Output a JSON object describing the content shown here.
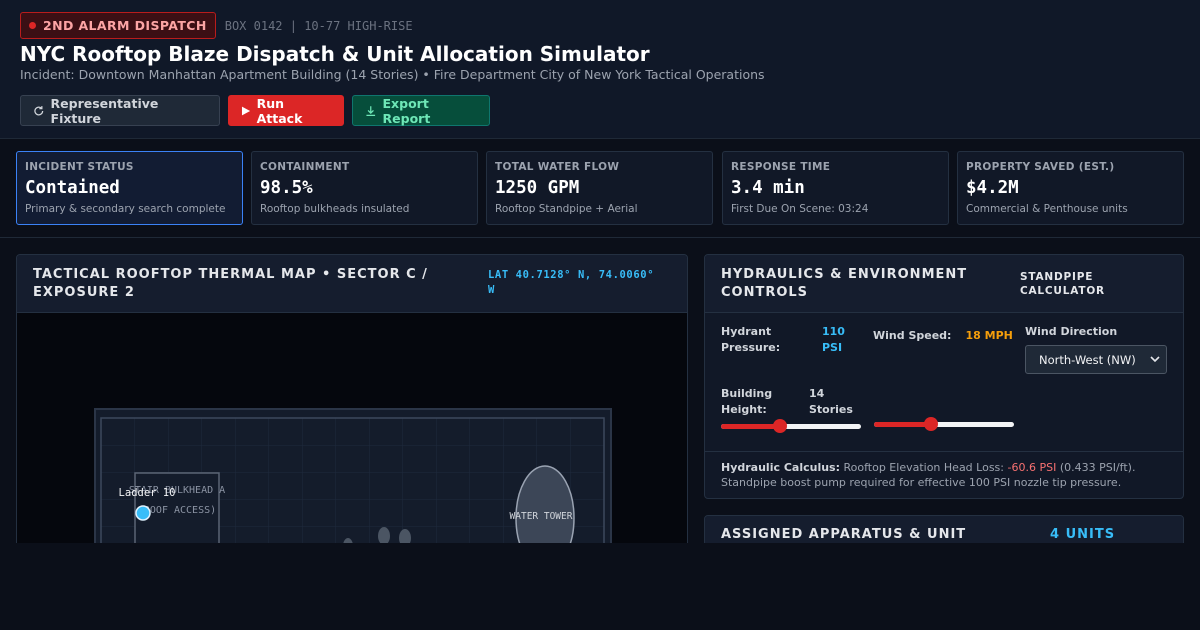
{
  "header": {
    "alarm_badge": "2ND ALARM DISPATCH",
    "box_code": "BOX 0142 | 10-77 HIGH-RISE",
    "title": "NYC Rooftop Blaze Dispatch & Unit Allocation Simulator",
    "subtitle": "Incident: Downtown Manhattan Apartment Building (14 Stories) • Fire Department City of New York Tactical Operations",
    "buttons": {
      "fixture": "Representative Fixture",
      "run": "Run Attack",
      "export": "Export Report"
    }
  },
  "stats": [
    {
      "label": "INCIDENT STATUS",
      "value": "Contained",
      "note": "Primary & secondary search complete"
    },
    {
      "label": "CONTAINMENT",
      "value": "98.5%",
      "note": "Rooftop bulkheads insulated"
    },
    {
      "label": "TOTAL WATER FLOW",
      "value": "1250 GPM",
      "note": "Rooftop Standpipe + Aerial"
    },
    {
      "label": "RESPONSE TIME",
      "value": "3.4 min",
      "note": "First Due On Scene: 03:24"
    },
    {
      "label": "PROPERTY SAVED (EST.)",
      "value": "$4.2M",
      "note": "Commercial & Penthouse units"
    }
  ],
  "map": {
    "title_line1": "TACTICAL ROOFTOP THERMAL MAP • SECTOR C /",
    "title_line2": "EXPOSURE 2",
    "coords_line1": "LAT 40.7128° N, 74.0060°",
    "coords_line2": "W",
    "bulkhead_line1": "STAIR BULKHEAD A",
    "bulkhead_line2": "(ROOF ACCESS)",
    "unit_label": "Ladder 10",
    "water_tower": "WATER TOWER"
  },
  "hydraulics": {
    "title_line1": "HYDRAULICS & ENVIRONMENT",
    "title_line2": "CONTROLS",
    "calc_line1": "STANDPIPE",
    "calc_line2": "CALCULATOR",
    "hydrant_label_1": "Hydrant",
    "hydrant_label_2": "Pressure:",
    "hydrant_value_1": "110",
    "hydrant_value_2": "PSI",
    "hydrant_level": 0.42,
    "wind_label": "Wind Speed:",
    "wind_value": "18 MPH",
    "wind_level": 0.41,
    "direction_label": "Wind Direction",
    "direction_selected": "North-West (NW)",
    "height_label_1": "Building",
    "height_label_2": "Height:",
    "height_value_1": "14",
    "height_value_2": "Stories",
    "height_level": 0.4,
    "calc_heading": "Hydraulic Calculus:",
    "calc_text_1": "Rooftop Elevation Head Loss:",
    "calc_loss": "-60.6 PSI",
    "calc_text_2": "(0.433 PSI/ft).",
    "calc_text_3": "Standpipe boost pump required for effective 100 PSI nozzle tip pressure."
  },
  "apparatus": {
    "title": "ASSIGNED APPARATUS & UNIT",
    "count": "4 UNITS"
  },
  "colors": {
    "accent_red": "#dc2626",
    "accent_blue": "#38bdf8",
    "accent_orange": "#f59e0b",
    "accent_green": "#6ee7b7"
  }
}
